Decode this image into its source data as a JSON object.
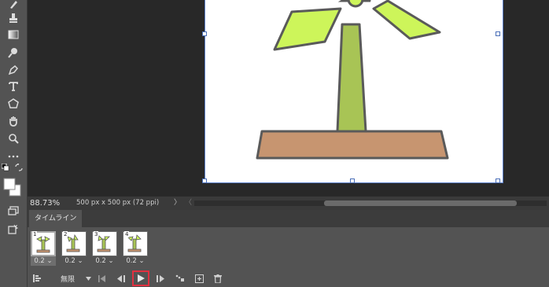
{
  "status_bar": {
    "zoom": "88.73%",
    "doc_info": "500 px x 500 px (72 ppi)",
    "arrow": "〉",
    "scroll_left": "〈"
  },
  "timeline": {
    "tab_label": "タイムライン",
    "frames": [
      {
        "number": "1",
        "delay": "0.2"
      },
      {
        "number": "2",
        "delay": "0.2"
      },
      {
        "number": "3",
        "delay": "0.2"
      },
      {
        "number": "4",
        "delay": "0.2"
      }
    ],
    "loop_value": "無限"
  },
  "icons": {
    "toolbar": [
      "brush-icon",
      "stamp-icon",
      "gradient-icon",
      "dodge-icon",
      "pen-icon",
      "type-icon",
      "shape-icon",
      "hand-icon",
      "zoom-icon",
      "more-icon",
      "default-colors-icon",
      "swap-colors-icon",
      "foreground-background-icon",
      "quick-mask-icon",
      "screen-mode-icon"
    ],
    "controls": [
      "convert-timeline-icon",
      "loop-dropdown-icon",
      "first-frame-icon",
      "previous-frame-icon",
      "play-icon",
      "next-frame-icon",
      "tween-icon",
      "duplicate-frame-icon",
      "delete-frame-icon"
    ]
  },
  "colors": {
    "accent_highlight": "#e03040",
    "blade": "#cdf55a",
    "tower": "#a8c455",
    "base": "#c79570",
    "outline": "#5a5a5a"
  }
}
